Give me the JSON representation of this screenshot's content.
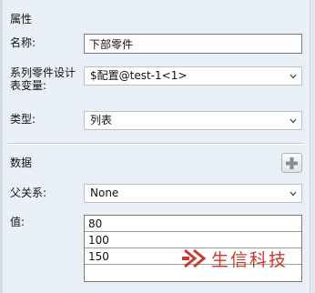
{
  "properties": {
    "section_title": "属性",
    "name_label": "名称:",
    "name_value": "下部零件",
    "variable_label_line1": "系列零件设计",
    "variable_label_line2": "表变量:",
    "variable_value": "$配置@test-1<1>",
    "type_label": "类型:",
    "type_value": "列表"
  },
  "data": {
    "section_title": "数据",
    "parent_label": "父关系:",
    "parent_value": "None",
    "values_label": "值:",
    "values": [
      "80",
      "100",
      "150",
      ""
    ]
  },
  "watermark": {
    "text": "生信科技"
  },
  "icons": {
    "add": "add-icon",
    "dropdown": "chevron-down-icon",
    "logo": "logo-icon"
  },
  "colors": {
    "panel_bg": "#eaf0f7",
    "add_icon": "#8c8c8c",
    "watermark": "#c93a2e"
  }
}
